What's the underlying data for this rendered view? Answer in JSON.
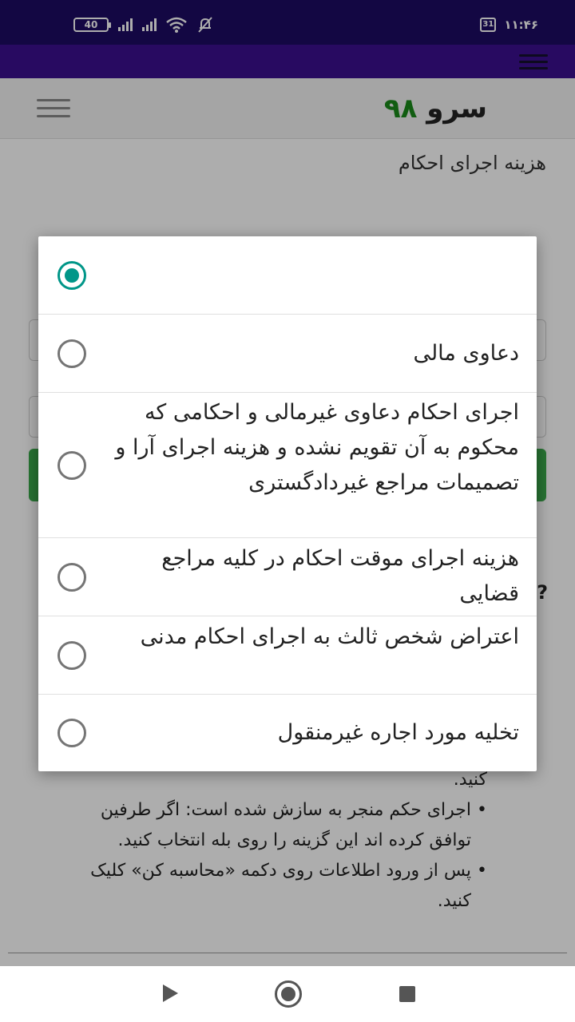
{
  "status_bar": {
    "battery": "40",
    "date_badge": "31",
    "time": "۱۱:۴۶"
  },
  "header": {
    "logo_word": "سرو",
    "logo_number": "۹۸",
    "page_title": "هزینه اجرای احکام"
  },
  "background_text": {
    "bullets_partial_top": "کنید.",
    "bullets": [
      "اجرای حکم منجر به سازش شده است: اگر طرفین توافق کرده اند این گزینه را روی بله انتخاب کنید.",
      "پس از ورود اطلاعات روی دکمه «محاسبه کن» کلیک کنید."
    ],
    "question_mark": "?"
  },
  "dialog": {
    "options": [
      {
        "label": "",
        "checked": true
      },
      {
        "label": "دعاوی مالی",
        "checked": false
      },
      {
        "label": "اجرای احکام دعاوی غیرمالی و احکامی که محکوم به آن تقویم نشده و هزینه اجرای آرا و تصمیمات مراجع غیردادگستری",
        "checked": false
      },
      {
        "label": "هزینه اجرای موقت احکام در کلیه مراجع قضایی",
        "checked": false
      },
      {
        "label": "اعتراض شخص ثالث به اجرای احکام مدنی",
        "checked": false
      },
      {
        "label": "تخلیه مورد اجاره غیرمنقول",
        "checked": false
      }
    ]
  },
  "colors": {
    "status_bar": "#1d0b63",
    "app_bar": "#3b0f8f",
    "radio_accent": "#009688",
    "logo_green": "#1a8a1a"
  }
}
